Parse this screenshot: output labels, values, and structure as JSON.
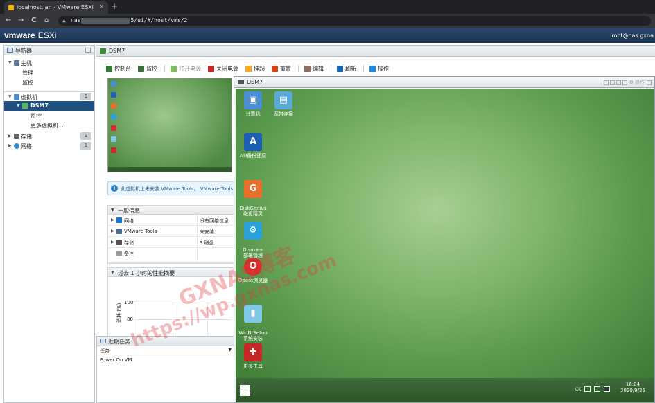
{
  "browser": {
    "tab_title": "localhost.lan - VMware ESXi",
    "close_glyph": "×",
    "new_tab_glyph": "+",
    "url_prefix": "nas",
    "url_suffix": "5/ui/#/host/vms/2",
    "nav": {
      "back": "←",
      "forward": "→",
      "reload": "C",
      "home": "⌂"
    }
  },
  "esxi": {
    "logo": "vmware",
    "product": "ESXi",
    "user": "root@nas.gxna"
  },
  "navigator": {
    "title": "导航器",
    "host": {
      "label": "主机",
      "children": [
        "管理",
        "监控"
      ]
    },
    "vms": {
      "label": "虚拟机",
      "badge": "1",
      "selected": "DSM7",
      "children": [
        "监控",
        "更多虚拟机..."
      ]
    },
    "storage": {
      "label": "存储",
      "badge": "1"
    },
    "network": {
      "label": "网络",
      "badge": "1"
    }
  },
  "main": {
    "title": "DSM7",
    "toolbar": [
      {
        "label": "控制台",
        "color": "#2e7d32",
        "disabled": false
      },
      {
        "label": "监控",
        "color": "#3c6e3c",
        "disabled": false
      },
      {
        "label": "打开电源",
        "color": "#7cbf5c",
        "disabled": true
      },
      {
        "label": "关闭电源",
        "color": "#c62828",
        "disabled": false
      },
      {
        "label": "挂起",
        "color": "#f9a825",
        "disabled": false
      },
      {
        "label": "重置",
        "color": "#d84315",
        "disabled": false
      },
      {
        "label": "编辑",
        "color": "#8d6e63",
        "disabled": false
      },
      {
        "label": "刷新",
        "color": "#1565c0",
        "disabled": false
      },
      {
        "label": "操作",
        "color": "#1e88e5",
        "disabled": false
      }
    ],
    "info_text": "此虚拟机上未安装 VMware Tools。 VMware Tools",
    "general": {
      "title": "一般信息",
      "rows": [
        {
          "key": "网络",
          "value": "没有网络信息",
          "color": "#1976d2"
        },
        {
          "key": "VMware Tools",
          "value": "未安装",
          "color": "#4f6d8c"
        },
        {
          "key": "存储",
          "value": "3 磁盘",
          "color": "#555555"
        },
        {
          "key": "备注",
          "value": "",
          "color": "#9e9e9e"
        }
      ]
    },
    "perf": {
      "title": "过去 1 小时的性能摘要",
      "y_ticks": [
        "100",
        "80"
      ],
      "ylabel": "消耗 (%)"
    }
  },
  "tasks": {
    "title": "近期任务",
    "column": "任务",
    "row": "Power On VM"
  },
  "console": {
    "title": "DSM7",
    "action": "操作",
    "desktop_icons": [
      {
        "label": "计算机",
        "color": "#4a8fd4",
        "glyph": "▣"
      },
      {
        "label": "宽带连接",
        "color": "#5aa9d6",
        "glyph": "▤"
      },
      {
        "label": "ATI备份还原",
        "color": "#1d5fb3",
        "glyph": "A"
      },
      {
        "label": "DiskGenius\n磁盘精灵",
        "color": "#e8702a",
        "glyph": "G"
      },
      {
        "label": "Dism++\n部署管理",
        "color": "#2aa1d8",
        "glyph": "⚙"
      },
      {
        "label": "Opera浏览器",
        "color": "#d32f2f",
        "glyph": "O"
      },
      {
        "label": "WinNtSetup\n系统安装",
        "color": "#7ec8e8",
        "glyph": "▮"
      },
      {
        "label": "更多工具",
        "color": "#c62828",
        "glyph": "✚"
      }
    ],
    "tray_lang": "CK",
    "time": "16:04",
    "date": "2020/9/25"
  },
  "watermark": {
    "line1": "GXNAS博客",
    "line2": "https://wp.gxnas.com"
  }
}
